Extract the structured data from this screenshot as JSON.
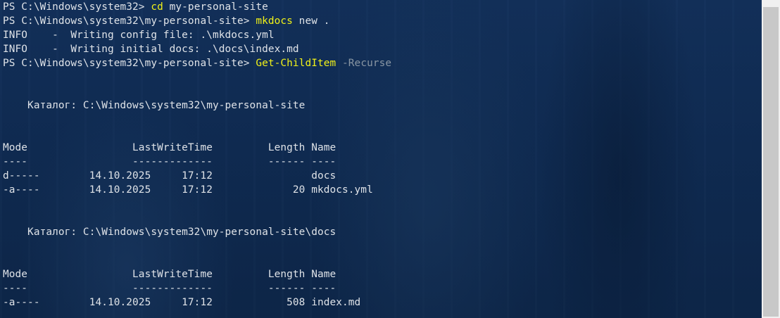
{
  "console": {
    "lines": [
      {
        "type": "prompt",
        "prompt": "PS C:\\Windows\\system32> ",
        "command": "cd",
        "args": " my-personal-site",
        "param": ""
      },
      {
        "type": "prompt",
        "prompt": "PS C:\\Windows\\system32\\my-personal-site> ",
        "command": "mkdocs",
        "args": " new .",
        "param": ""
      },
      {
        "type": "output",
        "text": "INFO    -  Writing config file: .\\mkdocs.yml"
      },
      {
        "type": "output",
        "text": "INFO    -  Writing initial docs: .\\docs\\index.md"
      },
      {
        "type": "prompt",
        "prompt": "PS C:\\Windows\\system32\\my-personal-site> ",
        "command": "Get-ChildItem",
        "args": " ",
        "param": "-Recurse"
      },
      {
        "type": "output",
        "text": ""
      },
      {
        "type": "output",
        "text": ""
      },
      {
        "type": "output",
        "text": "    Каталог: C:\\Windows\\system32\\my-personal-site"
      },
      {
        "type": "output",
        "text": ""
      },
      {
        "type": "output",
        "text": ""
      },
      {
        "type": "output",
        "text": "Mode                 LastWriteTime         Length Name"
      },
      {
        "type": "output",
        "text": "----                 -------------         ------ ----"
      },
      {
        "type": "output",
        "text": "d-----        14.10.2025     17:12                docs"
      },
      {
        "type": "output",
        "text": "-a----        14.10.2025     17:12             20 mkdocs.yml"
      },
      {
        "type": "output",
        "text": ""
      },
      {
        "type": "output",
        "text": ""
      },
      {
        "type": "output",
        "text": "    Каталог: C:\\Windows\\system32\\my-personal-site\\docs"
      },
      {
        "type": "output",
        "text": ""
      },
      {
        "type": "output",
        "text": ""
      },
      {
        "type": "output",
        "text": "Mode                 LastWriteTime         Length Name"
      },
      {
        "type": "output",
        "text": "----                 -------------         ------ ----"
      },
      {
        "type": "output",
        "text": "-a----        14.10.2025     17:12            508 index.md"
      }
    ]
  },
  "colors": {
    "background": "#0f2a4c",
    "text": "#dfe3e8",
    "command": "#f2f218",
    "parameter": "#8a97a4",
    "scrollbar_track": "#f0f0f0",
    "scrollbar_thumb": "#c8c8c8"
  }
}
